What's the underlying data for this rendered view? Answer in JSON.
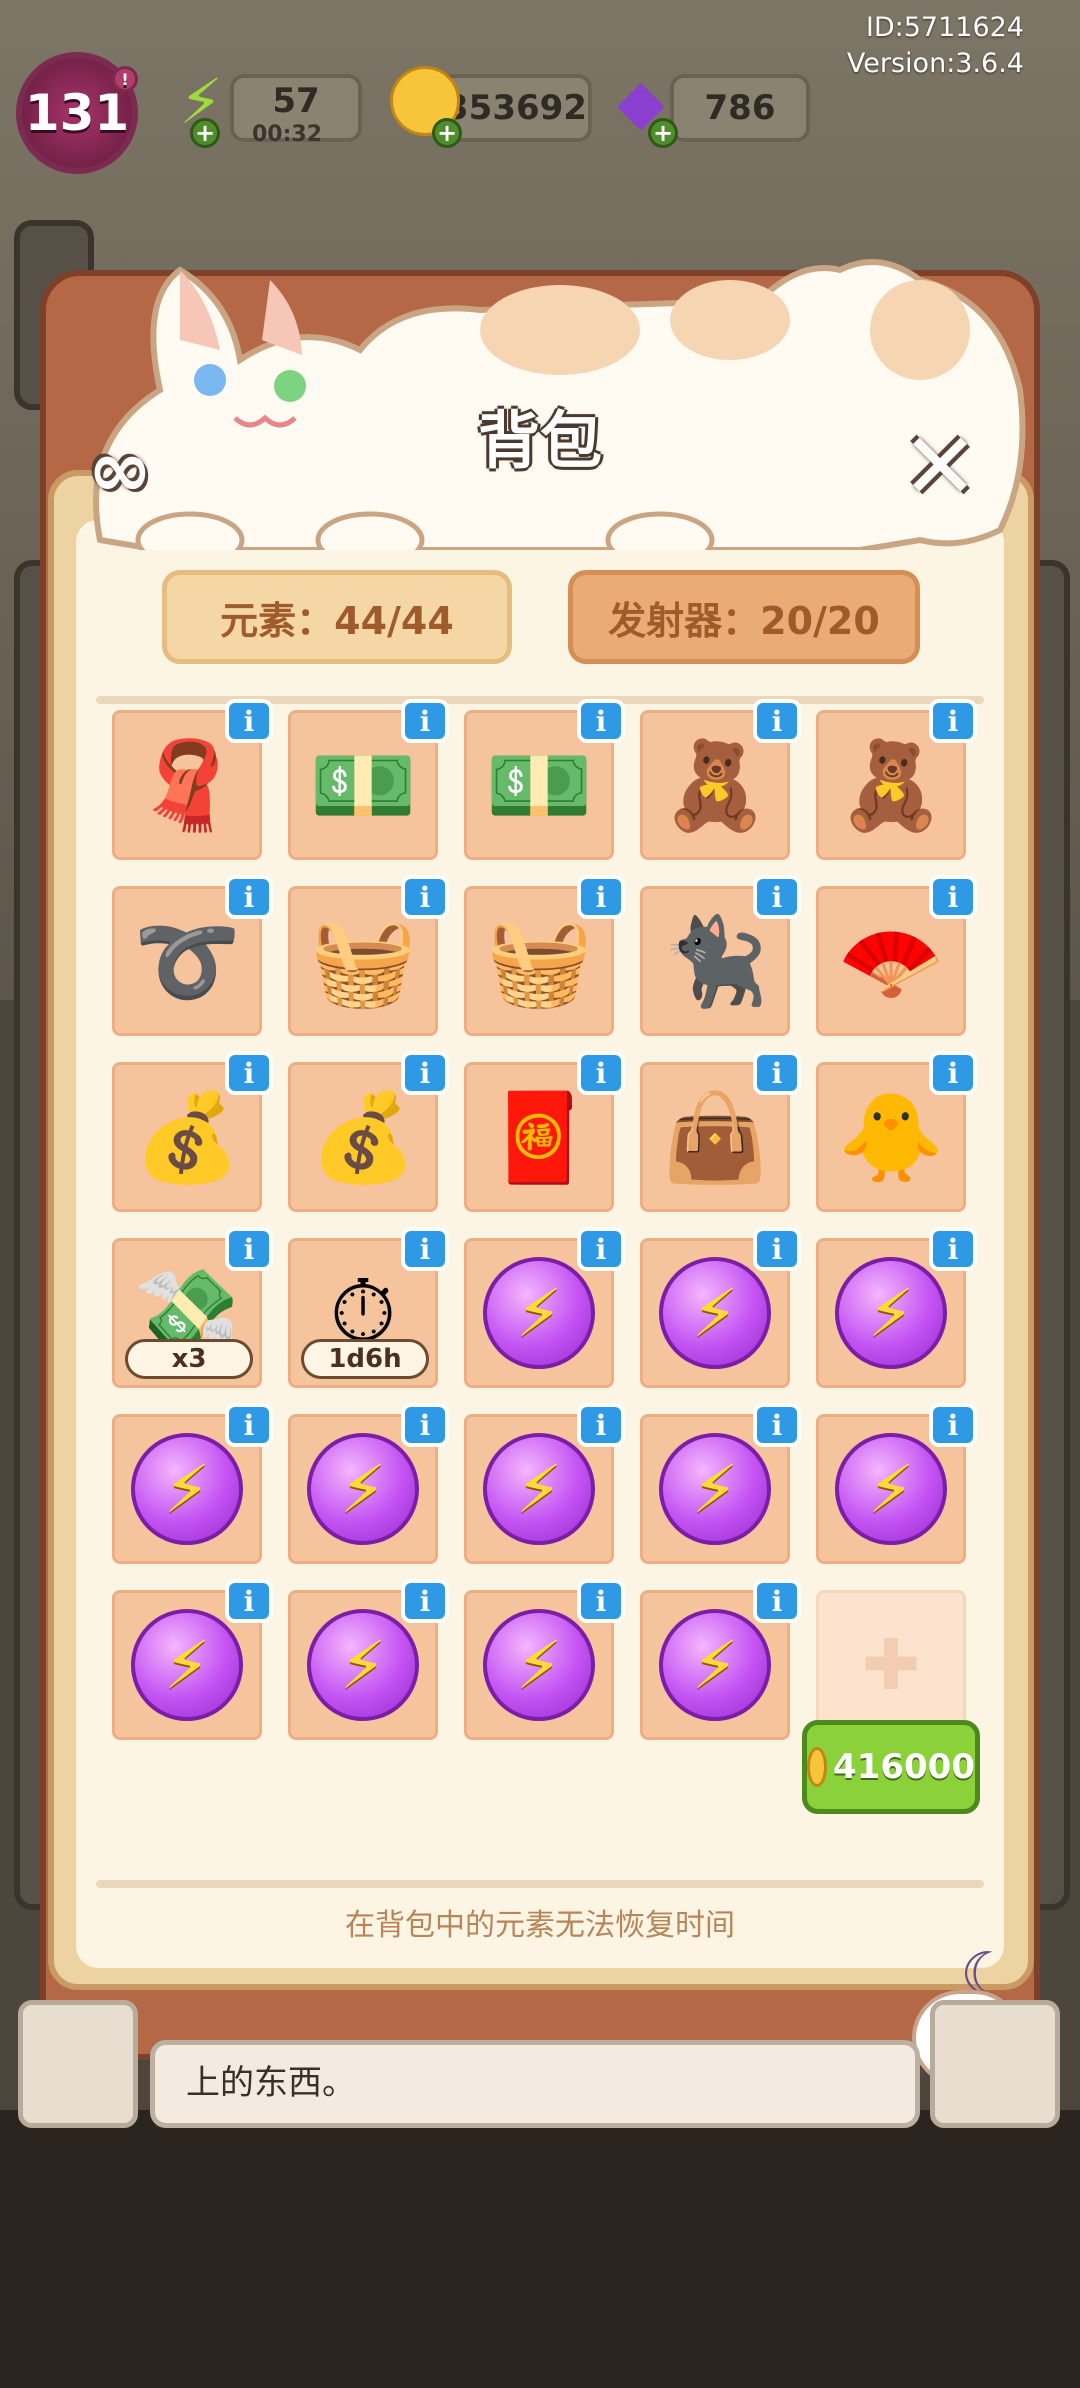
{
  "header": {
    "id_text": "ID:5711624",
    "version_text": "Version:3.6.4",
    "level": "131",
    "energy": "57",
    "energy_timer": "00:32",
    "coins": "353692",
    "gems": "786"
  },
  "panel": {
    "title": "背包",
    "elements_label": "元素：44/44",
    "emitters_label": "发射器：20/20",
    "footer_note": "在背包中的元素无法恢复时间",
    "buy_price": "416000"
  },
  "slots": [
    {
      "icon": "red-scarf-bag-icon",
      "emoji": "🧣"
    },
    {
      "icon": "cash-stack-icon",
      "emoji": "💵"
    },
    {
      "icon": "cash-pile-icon",
      "emoji": "💵"
    },
    {
      "icon": "green-bear-cushion-icon",
      "emoji": "🧸"
    },
    {
      "icon": "green-bear-plush-icon",
      "emoji": "🧸"
    },
    {
      "icon": "rattan-coil-icon",
      "emoji": "➰"
    },
    {
      "icon": "woven-basket-rough-icon",
      "emoji": "🧺"
    },
    {
      "icon": "woven-basket-icon",
      "emoji": "🧺"
    },
    {
      "icon": "tuxedo-cat-figure-icon",
      "emoji": "🐈‍⬛"
    },
    {
      "icon": "umbrella-fan-icon",
      "emoji": "🪭"
    },
    {
      "icon": "gold-treasure-basin-icon",
      "emoji": "💰"
    },
    {
      "icon": "gold-treasure-bag-icon",
      "emoji": "💰"
    },
    {
      "icon": "fortune-god-icon",
      "emoji": "🧧"
    },
    {
      "icon": "black-handbag-icon",
      "emoji": "👜"
    },
    {
      "icon": "yellow-chick-icon",
      "emoji": "🐥"
    },
    {
      "icon": "cash-arrow-icon",
      "emoji": "💸",
      "badge": "x3"
    },
    {
      "icon": "stopwatch-icon",
      "emoji": "⏱",
      "badge": "1d6h"
    },
    {
      "icon": "energy-orb-icon",
      "orb": true
    },
    {
      "icon": "energy-orb-icon",
      "orb": true
    },
    {
      "icon": "energy-orb-icon",
      "orb": true
    },
    {
      "icon": "energy-orb-icon",
      "orb": true
    },
    {
      "icon": "energy-orb-icon",
      "orb": true
    },
    {
      "icon": "energy-orb-icon",
      "orb": true
    },
    {
      "icon": "energy-orb-icon",
      "orb": true
    },
    {
      "icon": "energy-orb-icon",
      "orb": true
    },
    {
      "icon": "energy-orb-icon",
      "orb": true
    },
    {
      "icon": "energy-orb-icon",
      "orb": true
    },
    {
      "icon": "energy-orb-icon",
      "orb": true
    },
    {
      "icon": "energy-orb-icon",
      "orb": true
    },
    {
      "icon": "empty-slot-plus-icon",
      "empty": true
    }
  ],
  "background": {
    "hint_text": "上的东西。"
  }
}
